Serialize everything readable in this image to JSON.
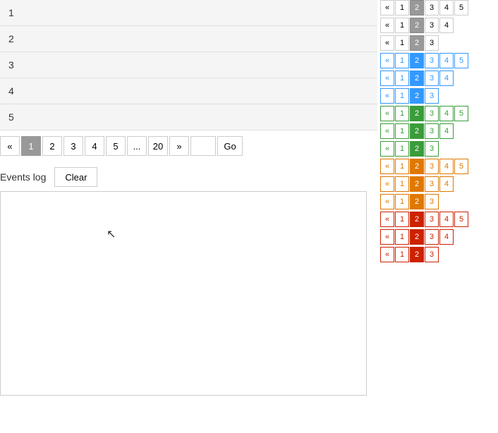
{
  "table": {
    "rows": [
      "1",
      "2",
      "3",
      "4",
      "5"
    ]
  },
  "pagination": {
    "prev": "«",
    "next": "»",
    "pages": [
      "1",
      "2",
      "3",
      "4",
      "5"
    ],
    "ellipsis": "...",
    "last": "20",
    "active": "1",
    "go_label": "Go"
  },
  "events": {
    "label": "Events log",
    "clear_label": "Clear"
  },
  "right_paginators": [
    {
      "style": "grey",
      "items": [
        "«",
        "1",
        "2",
        "3",
        "4",
        "5"
      ],
      "active_index": 2
    },
    {
      "style": "grey",
      "items": [
        "«",
        "1",
        "2",
        "3",
        "4"
      ],
      "active_index": 2
    },
    {
      "style": "grey",
      "items": [
        "«",
        "1",
        "2",
        "3"
      ],
      "active_index": 2
    },
    {
      "style": "blue-outline",
      "items": [
        "«",
        "1",
        "2",
        "3",
        "4",
        "5"
      ],
      "active_index": 2
    },
    {
      "style": "blue-outline",
      "items": [
        "«",
        "1",
        "2",
        "3",
        "4"
      ],
      "active_index": 2
    },
    {
      "style": "blue-outline",
      "items": [
        "«",
        "1",
        "2",
        "3"
      ],
      "active_index": 2
    },
    {
      "style": "green-outline",
      "items": [
        "«",
        "1",
        "2",
        "3",
        "4",
        "5"
      ],
      "active_index": 2
    },
    {
      "style": "green-outline",
      "items": [
        "«",
        "1",
        "2",
        "3",
        "4"
      ],
      "active_index": 2
    },
    {
      "style": "green-outline",
      "items": [
        "«",
        "1",
        "2",
        "3"
      ],
      "active_index": 2
    },
    {
      "style": "orange-outline",
      "items": [
        "«",
        "1",
        "2",
        "3",
        "4",
        "5"
      ],
      "active_index": 2
    },
    {
      "style": "orange-outline",
      "items": [
        "«",
        "1",
        "2",
        "3",
        "4"
      ],
      "active_index": 2
    },
    {
      "style": "orange-outline",
      "items": [
        "«",
        "1",
        "2",
        "3"
      ],
      "active_index": 2
    },
    {
      "style": "red-outline",
      "items": [
        "«",
        "1",
        "2",
        "3",
        "4",
        "5"
      ],
      "active_index": 2
    },
    {
      "style": "red-outline",
      "items": [
        "«",
        "1",
        "2",
        "3",
        "4"
      ],
      "active_index": 2
    },
    {
      "style": "red-outline",
      "items": [
        "«",
        "1",
        "2",
        "3"
      ],
      "active_index": 2
    }
  ]
}
